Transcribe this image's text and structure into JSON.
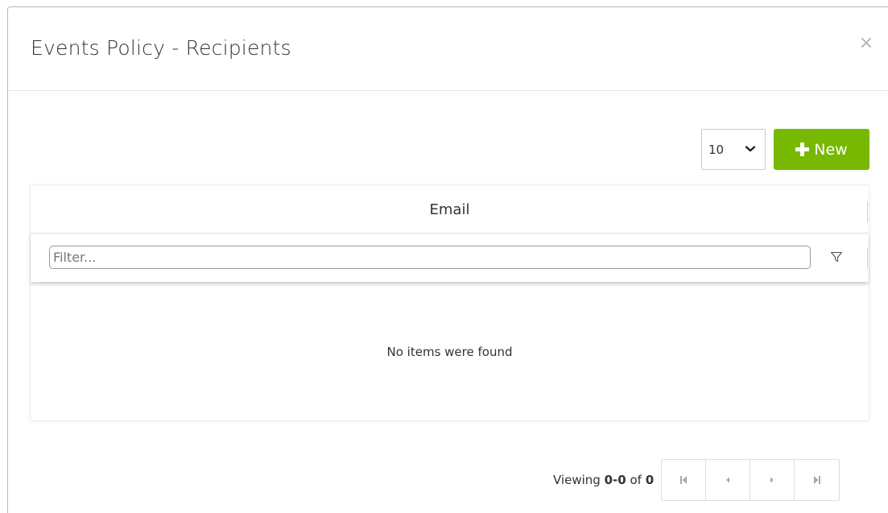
{
  "dialog": {
    "title": "Events Policy - Recipients",
    "close_glyph": "×"
  },
  "toolbar": {
    "page_size_value": "10",
    "new_button_label": "New"
  },
  "grid": {
    "columns": [
      "Email"
    ],
    "filter_placeholder": "Filter...",
    "empty_message": "No items were found"
  },
  "pager": {
    "viewing_prefix": "Viewing",
    "range": "0-0",
    "of_word": "of",
    "total": "0"
  },
  "colors": {
    "accent_green": "#76b900",
    "border_gray": "#dddddd"
  },
  "icons": [
    "close-icon",
    "chevron-down-icon",
    "plus-icon",
    "filter-icon",
    "first-page-icon",
    "prev-page-icon",
    "next-page-icon",
    "last-page-icon"
  ]
}
